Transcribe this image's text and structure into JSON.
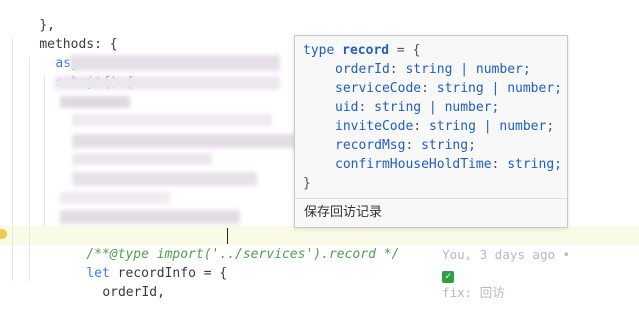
{
  "editor": {
    "lines": {
      "l1": "},",
      "l2_name": "methods",
      "l2_rest": ": {",
      "l3_kw": "async",
      "l3_fn": "submit",
      "l3_rest": "() {",
      "l4_kw": "try",
      "l4_rest": " {",
      "l12_comment": "/**@type import('../services').record */",
      "l13_kw": "let",
      "l13_rest": " recordInfo = {",
      "l14": "orderId,"
    },
    "inline_blame": {
      "text": "You, 3 days ago •",
      "commit": "fix: 回访"
    }
  },
  "hover": {
    "lines": [
      {
        "prop": "orderId",
        "type": "string | number;"
      },
      {
        "prop": "serviceCode",
        "type": "string | number;"
      },
      {
        "prop": "uid",
        "type": "string | number;"
      },
      {
        "prop": "inviteCode",
        "type": "string | number;"
      },
      {
        "prop": "recordMsg",
        "type": "string;"
      },
      {
        "prop": "confirmHouseHoldTime",
        "type": "string;"
      }
    ],
    "header_kw": "type",
    "header_name": "record",
    "header_rest": " = {",
    "closing": "}",
    "doc": "保存回访记录"
  },
  "colors": {
    "keyword": "#4078f2",
    "function": "#a626a4",
    "comment": "#50a14f"
  },
  "icons": [
    "check-icon",
    "lightbulb-icon"
  ]
}
